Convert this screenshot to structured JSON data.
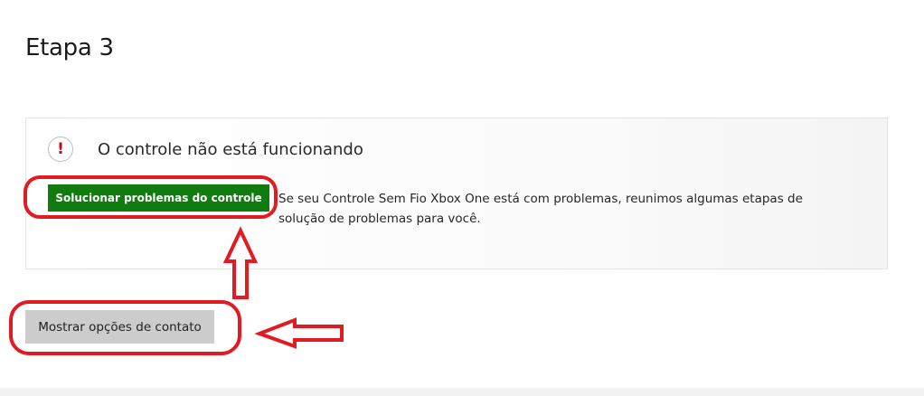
{
  "page": {
    "step_title": "Etapa 3"
  },
  "card": {
    "icon": "exclamation-icon",
    "title": "O controle não está funcionando",
    "button_label": "Solucionar problemas do controle",
    "description": "Se seu Controle Sem Fio Xbox One está com problemas, reunimos algumas etapas de solução de problemas para você."
  },
  "contact": {
    "button_label": "Mostrar opções de contato"
  },
  "colors": {
    "primary_button": "#107c10",
    "secondary_button": "#cccccc",
    "alert_icon": "#d0021b",
    "annotation": "#e21b23"
  },
  "annotation_icons": [
    "up-arrow-annotation-icon",
    "left-arrow-annotation-icon"
  ]
}
